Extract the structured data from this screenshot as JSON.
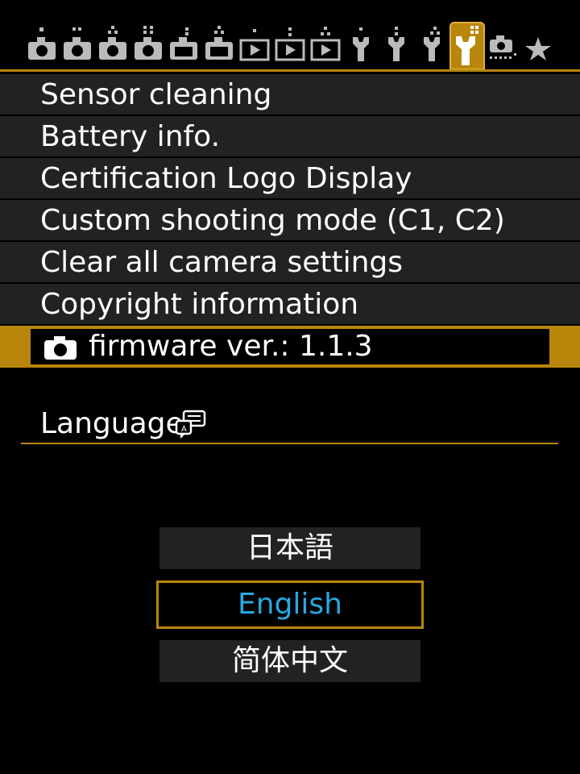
{
  "tabs": [
    {
      "icon": "camera-tab-1-icon"
    },
    {
      "icon": "camera-tab-2-icon"
    },
    {
      "icon": "camera-tab-3-icon"
    },
    {
      "icon": "camera-tab-4-icon"
    },
    {
      "icon": "camera-tab-5-icon"
    },
    {
      "icon": "camera-tab-6-icon"
    },
    {
      "icon": "playback-tab-1-icon"
    },
    {
      "icon": "playback-tab-2-icon"
    },
    {
      "icon": "playback-tab-3-icon"
    },
    {
      "icon": "setup-tab-1-icon"
    },
    {
      "icon": "setup-tab-2-icon"
    },
    {
      "icon": "setup-tab-3-icon"
    },
    {
      "icon": "setup-tab-4-icon",
      "active": true
    },
    {
      "icon": "custom-function-tab-icon"
    },
    {
      "icon": "my-menu-star-icon"
    }
  ],
  "menu": {
    "items": [
      {
        "label": "Sensor cleaning"
      },
      {
        "label": "Battery info."
      },
      {
        "label": "Certification Logo Display"
      },
      {
        "label": "Custom shooting mode (C1, C2)"
      },
      {
        "label": "Clear all camera settings"
      },
      {
        "label": "Copyright information"
      },
      {
        "label": "firmware ver.: 1.1.3",
        "selected": true
      }
    ]
  },
  "language": {
    "title": "Language",
    "options": [
      "日本語",
      "English",
      "简体中文"
    ],
    "selected": "English"
  },
  "colors": {
    "accent": "#b8860b",
    "selected_text": "#29a8e0",
    "row_bg": "#222222",
    "background": "#000000"
  }
}
